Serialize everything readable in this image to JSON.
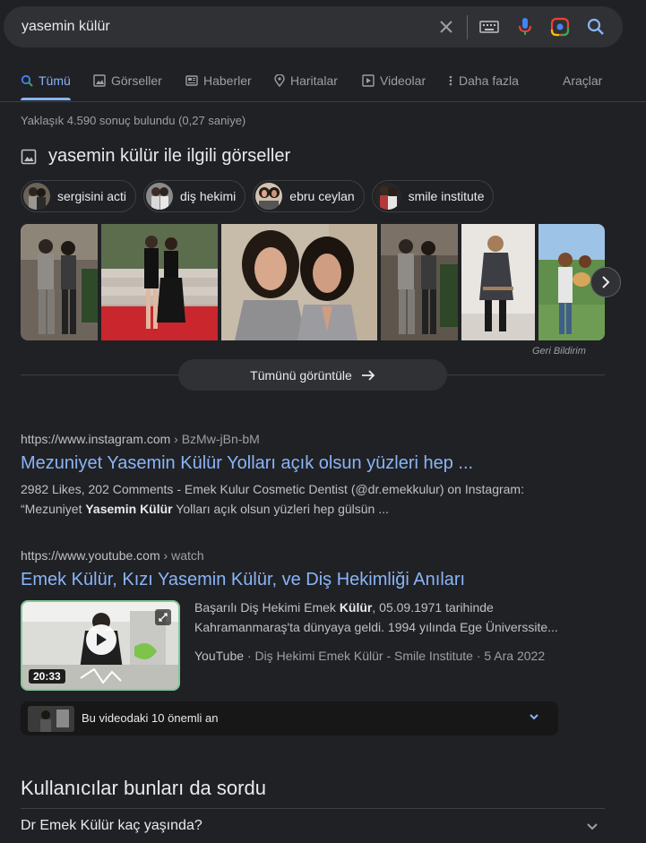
{
  "search": {
    "query": "yasemin külür"
  },
  "tabs": [
    {
      "label": "Tümü"
    },
    {
      "label": "Görseller"
    },
    {
      "label": "Haberler"
    },
    {
      "label": "Haritalar"
    },
    {
      "label": "Videolar"
    },
    {
      "label": "Daha fazla"
    }
  ],
  "tools_label": "Araçlar",
  "stats": "Yaklaşık 4.590 sonuç bulundu (0,27 saniye)",
  "images_section": {
    "heading": "yasemin külür ile ilgili görseller",
    "chips": [
      "sergisini acti",
      "diş hekimi",
      "ebru ceylan",
      "smile institute"
    ],
    "feedback": "Geri Bildirim",
    "view_all": "Tümünü görüntüle"
  },
  "results": [
    {
      "url": "https://www.instagram.com",
      "breadcrumb": "› BzMw-jBn-bM",
      "title": "Mezuniyet Yasemin Külür Yolları açık olsun yüzleri hep ...",
      "snippet_line1": "2982 Likes, 202 Comments - Emek Kulur Cosmetic Dentist (@dr.emekkulur) on Instagram:",
      "snippet_pre": "“Mezuniyet ",
      "snippet_bold": "Yasemin Külür",
      "snippet_post": " Yolları açık olsun yüzleri hep gülsün ..."
    },
    {
      "url": "https://www.youtube.com",
      "breadcrumb": "› watch",
      "title": "Emek Külür, Kızı Yasemin Külür, ve Diş Hekimliği Anıları",
      "duration": "20:33",
      "desc_pre": "Başarılı Diş Hekimi Emek ",
      "desc_bold": "Külür",
      "desc_post": ", 05.09.1971 tarihinde Kahramanmaraş'ta dünyaya geldi. 1994 yılında Ege Üniverssite...",
      "source": "YouTube",
      "meta": " · Diş Hekimi Emek Külür - Smile Institute · 5 Ara 2022",
      "moments": "Bu videodaki 10 önemli an"
    }
  ],
  "paa": {
    "title": "Kullanıcılar bunları da sordu",
    "questions": [
      "Dr Emek Külür kaç yaşında?"
    ]
  }
}
